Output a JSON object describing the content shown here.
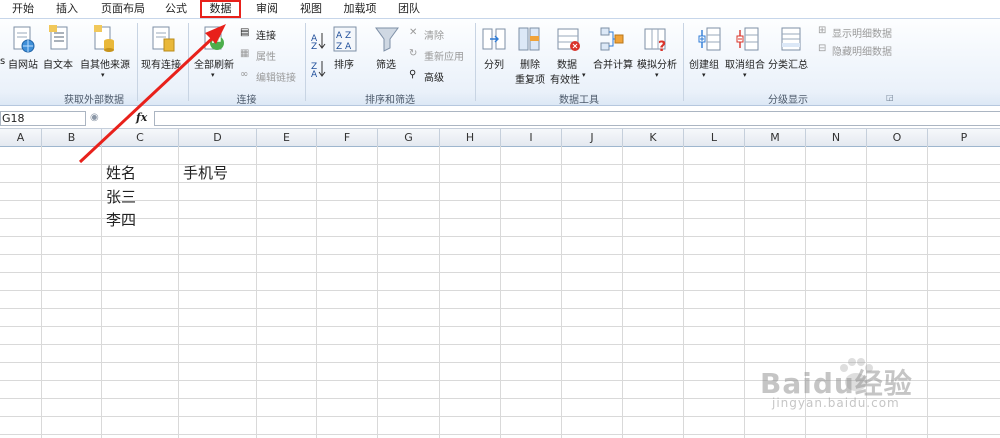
{
  "tabs": [
    "开始",
    "插入",
    "页面布局",
    "公式",
    "数据",
    "审阅",
    "视图",
    "加载项",
    "团队"
  ],
  "active_tab": "数据",
  "ribbon": {
    "get_external": {
      "from_web": "自网站",
      "from_text": "自文本",
      "from_other": "自其他来源",
      "existing": "现有连接",
      "title": "获取外部数据",
      "partial_left": "s"
    },
    "connections": {
      "refresh_all": "全部刷新",
      "connections": "连接",
      "properties": "属性",
      "edit_links": "编辑链接",
      "title": "连接"
    },
    "sort_filter": {
      "sort": "排序",
      "filter": "筛选",
      "clear": "清除",
      "reapply": "重新应用",
      "advanced": "高级",
      "title": "排序和筛选"
    },
    "data_tools": {
      "text_to_columns": "分列",
      "remove_dup_1": "删除",
      "remove_dup_2": "重复项",
      "validation_1": "数据",
      "validation_2": "有效性",
      "consolidate": "合并计算",
      "whatif": "模拟分析",
      "title": "数据工具"
    },
    "outline": {
      "group": "创建组",
      "ungroup": "取消组合",
      "subtotal": "分类汇总",
      "show_detail": "显示明细数据",
      "hide_detail": "隐藏明细数据",
      "title": "分级显示"
    }
  },
  "formula_bar": {
    "name_box": "G18",
    "fx": "fx",
    "content": ""
  },
  "columns": [
    "A",
    "B",
    "C",
    "D",
    "E",
    "F",
    "G",
    "H",
    "I",
    "J",
    "K",
    "L",
    "M",
    "N",
    "O",
    "P"
  ],
  "cells": {
    "c1": "姓名",
    "d1": "手机号",
    "c2": "张三",
    "c3": "李四"
  },
  "watermark": {
    "brand": "Baidu经验",
    "url": "jingyan.baidu.com"
  },
  "colors": {
    "highlight": "#e8211b",
    "ribbon_bg": "#eaf1fa",
    "grid": "#d9d9d9"
  }
}
